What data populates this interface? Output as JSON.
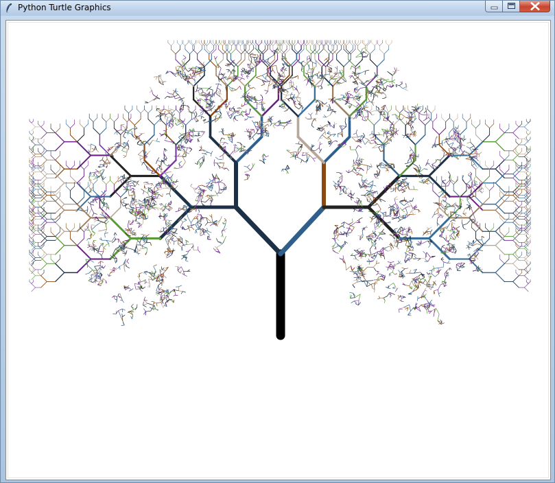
{
  "window": {
    "title": "Python Turtle Graphics",
    "icon": "feather-icon"
  },
  "caption_buttons": {
    "minimize_icon": "minimize-icon",
    "maximize_icon": "maximize-icon",
    "close_icon": "close-icon"
  },
  "canvas": {
    "background": "#ffffff",
    "drawing": "fractal-tree",
    "trunk_color": "#000000",
    "branch_colors": [
      "#1c3048",
      "#2f5f8a",
      "#6a1f82",
      "#8b4a12",
      "#5a9a3a",
      "#b8a898",
      "#3a6e9a",
      "#7b3aa0",
      "#a08060",
      "#222222"
    ]
  }
}
